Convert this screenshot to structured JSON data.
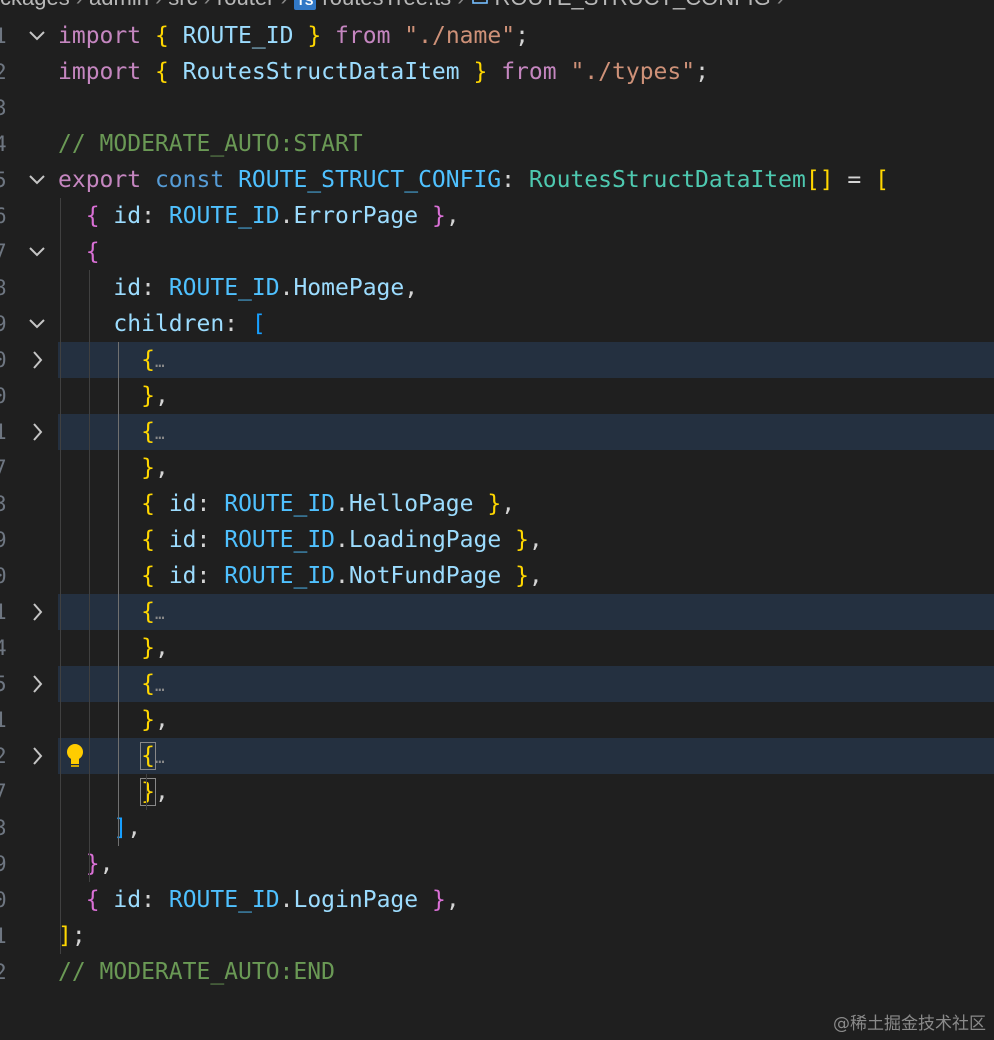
{
  "breadcrumb": {
    "segments": [
      "ckages",
      "admin",
      "src",
      "router",
      "routesTree.ts",
      "ROUTE_STRUCT_CONFIG"
    ],
    "separator": "›",
    "ts_badge": "TS",
    "symbol_icon": "symbol-constant-icon"
  },
  "editor": {
    "line_numbers": [
      "1",
      "2",
      "3",
      "4",
      "5",
      "6",
      "7",
      "8",
      "9",
      "0",
      "0",
      "1",
      "7",
      "3",
      "9",
      "0",
      "1",
      "4",
      "5",
      "1",
      "2",
      "7",
      "3",
      "9",
      "0",
      "1",
      "2"
    ],
    "lines": [
      {
        "tokens": [
          [
            "import",
            "kw-purple"
          ],
          [
            " "
          ],
          [
            "{",
            "b1"
          ],
          [
            " "
          ],
          [
            "ROUTE_ID",
            "var"
          ],
          [
            " "
          ],
          [
            "}",
            "b1"
          ],
          [
            " "
          ],
          [
            "from",
            "kw-purple"
          ],
          [
            " "
          ],
          [
            "\"./name\"",
            "str"
          ],
          [
            ";",
            "punc"
          ]
        ]
      },
      {
        "tokens": [
          [
            "import",
            "kw-purple"
          ],
          [
            " "
          ],
          [
            "{",
            "b1"
          ],
          [
            " "
          ],
          [
            "RoutesStructDataItem",
            "var"
          ],
          [
            " "
          ],
          [
            "}",
            "b1"
          ],
          [
            " "
          ],
          [
            "from",
            "kw-purple"
          ],
          [
            " "
          ],
          [
            "\"./types\"",
            "str"
          ],
          [
            ";",
            "punc"
          ]
        ]
      },
      {
        "tokens": []
      },
      {
        "tokens": [
          [
            "// MODERATE_AUTO:START",
            "comment"
          ]
        ]
      },
      {
        "tokens": [
          [
            "export",
            "kw-purple"
          ],
          [
            " "
          ],
          [
            "const",
            "kw-blue"
          ],
          [
            " "
          ],
          [
            "ROUTE_STRUCT_CONFIG",
            "const"
          ],
          [
            ":",
            "punc"
          ],
          [
            " "
          ],
          [
            "RoutesStructDataItem",
            "type"
          ],
          [
            "[]",
            "b1"
          ],
          [
            " "
          ],
          [
            "=",
            "punc"
          ],
          [
            " "
          ],
          [
            "[",
            "b1"
          ]
        ]
      },
      {
        "tokens": [
          [
            "  "
          ],
          [
            "{",
            "b2"
          ],
          [
            " "
          ],
          [
            "id",
            "var"
          ],
          [
            ":",
            "punc"
          ],
          [
            " "
          ],
          [
            "ROUTE_ID",
            "const"
          ],
          [
            ".",
            "punc"
          ],
          [
            "ErrorPage",
            "var"
          ],
          [
            " "
          ],
          [
            "}",
            "b2"
          ],
          [
            ",",
            "punc"
          ]
        ]
      },
      {
        "tokens": [
          [
            "  "
          ],
          [
            "{",
            "b2"
          ]
        ]
      },
      {
        "tokens": [
          [
            "    "
          ],
          [
            "id",
            "var"
          ],
          [
            ":",
            "punc"
          ],
          [
            " "
          ],
          [
            "ROUTE_ID",
            "const"
          ],
          [
            ".",
            "punc"
          ],
          [
            "HomePage",
            "var"
          ],
          [
            ",",
            "punc"
          ]
        ]
      },
      {
        "tokens": [
          [
            "    "
          ],
          [
            "children",
            "var"
          ],
          [
            ":",
            "punc"
          ],
          [
            " "
          ],
          [
            "[",
            "b3"
          ]
        ]
      },
      {
        "tokens": [
          [
            "      "
          ],
          [
            "{",
            "b1"
          ],
          [
            "…",
            "ellipsis"
          ]
        ]
      },
      {
        "tokens": [
          [
            "      "
          ],
          [
            "}",
            "b1"
          ],
          [
            ",",
            "punc"
          ]
        ]
      },
      {
        "tokens": [
          [
            "      "
          ],
          [
            "{",
            "b1"
          ],
          [
            "…",
            "ellipsis"
          ]
        ]
      },
      {
        "tokens": [
          [
            "      "
          ],
          [
            "}",
            "b1"
          ],
          [
            ",",
            "punc"
          ]
        ]
      },
      {
        "tokens": [
          [
            "      "
          ],
          [
            "{",
            "b1"
          ],
          [
            " "
          ],
          [
            "id",
            "var"
          ],
          [
            ":",
            "punc"
          ],
          [
            " "
          ],
          [
            "ROUTE_ID",
            "const"
          ],
          [
            ".",
            "punc"
          ],
          [
            "HelloPage",
            "var"
          ],
          [
            " "
          ],
          [
            "}",
            "b1"
          ],
          [
            ",",
            "punc"
          ]
        ]
      },
      {
        "tokens": [
          [
            "      "
          ],
          [
            "{",
            "b1"
          ],
          [
            " "
          ],
          [
            "id",
            "var"
          ],
          [
            ":",
            "punc"
          ],
          [
            " "
          ],
          [
            "ROUTE_ID",
            "const"
          ],
          [
            ".",
            "punc"
          ],
          [
            "LoadingPage",
            "var"
          ],
          [
            " "
          ],
          [
            "}",
            "b1"
          ],
          [
            ",",
            "punc"
          ]
        ]
      },
      {
        "tokens": [
          [
            "      "
          ],
          [
            "{",
            "b1"
          ],
          [
            " "
          ],
          [
            "id",
            "var"
          ],
          [
            ":",
            "punc"
          ],
          [
            " "
          ],
          [
            "ROUTE_ID",
            "const"
          ],
          [
            ".",
            "punc"
          ],
          [
            "NotFundPage",
            "var"
          ],
          [
            " "
          ],
          [
            "}",
            "b1"
          ],
          [
            ",",
            "punc"
          ]
        ]
      },
      {
        "tokens": [
          [
            "      "
          ],
          [
            "{",
            "b1"
          ],
          [
            "…",
            "ellipsis"
          ]
        ]
      },
      {
        "tokens": [
          [
            "      "
          ],
          [
            "}",
            "b1"
          ],
          [
            ",",
            "punc"
          ]
        ]
      },
      {
        "tokens": [
          [
            "      "
          ],
          [
            "{",
            "b1"
          ],
          [
            "…",
            "ellipsis"
          ]
        ]
      },
      {
        "tokens": [
          [
            "      "
          ],
          [
            "}",
            "b1"
          ],
          [
            ",",
            "punc"
          ]
        ]
      },
      {
        "tokens": [
          [
            "      "
          ],
          [
            "{",
            "b1 bracket-match"
          ],
          [
            "…",
            "ellipsis"
          ]
        ]
      },
      {
        "tokens": [
          [
            "      "
          ],
          [
            "}",
            "b1 bracket-match"
          ],
          [
            ",",
            "punc"
          ]
        ]
      },
      {
        "tokens": [
          [
            "    "
          ],
          [
            "]",
            "b3"
          ],
          [
            ",",
            "punc"
          ]
        ]
      },
      {
        "tokens": [
          [
            "  "
          ],
          [
            "}",
            "b2"
          ],
          [
            ",",
            "punc"
          ]
        ]
      },
      {
        "tokens": [
          [
            "  "
          ],
          [
            "{",
            "b2"
          ],
          [
            " "
          ],
          [
            "id",
            "var"
          ],
          [
            ":",
            "punc"
          ],
          [
            " "
          ],
          [
            "ROUTE_ID",
            "const"
          ],
          [
            ".",
            "punc"
          ],
          [
            "LoginPage",
            "var"
          ],
          [
            " "
          ],
          [
            "}",
            "b2"
          ],
          [
            ",",
            "punc"
          ]
        ]
      },
      {
        "tokens": [
          [
            "]",
            "b1"
          ],
          [
            ";",
            "punc"
          ]
        ]
      },
      {
        "tokens": [
          [
            "// MODERATE_AUTO:END",
            "comment"
          ]
        ]
      }
    ],
    "fold_markers": {
      "0": "expanded",
      "4": "expanded",
      "6": "expanded",
      "8": "expanded",
      "9": "collapsed",
      "11": "collapsed",
      "16": "collapsed",
      "18": "collapsed",
      "20": "collapsed"
    },
    "highlighted_lines": [
      9,
      11,
      16,
      18,
      20
    ],
    "lightbulb_line": 20
  },
  "watermark": "@稀土掘金技术社区"
}
